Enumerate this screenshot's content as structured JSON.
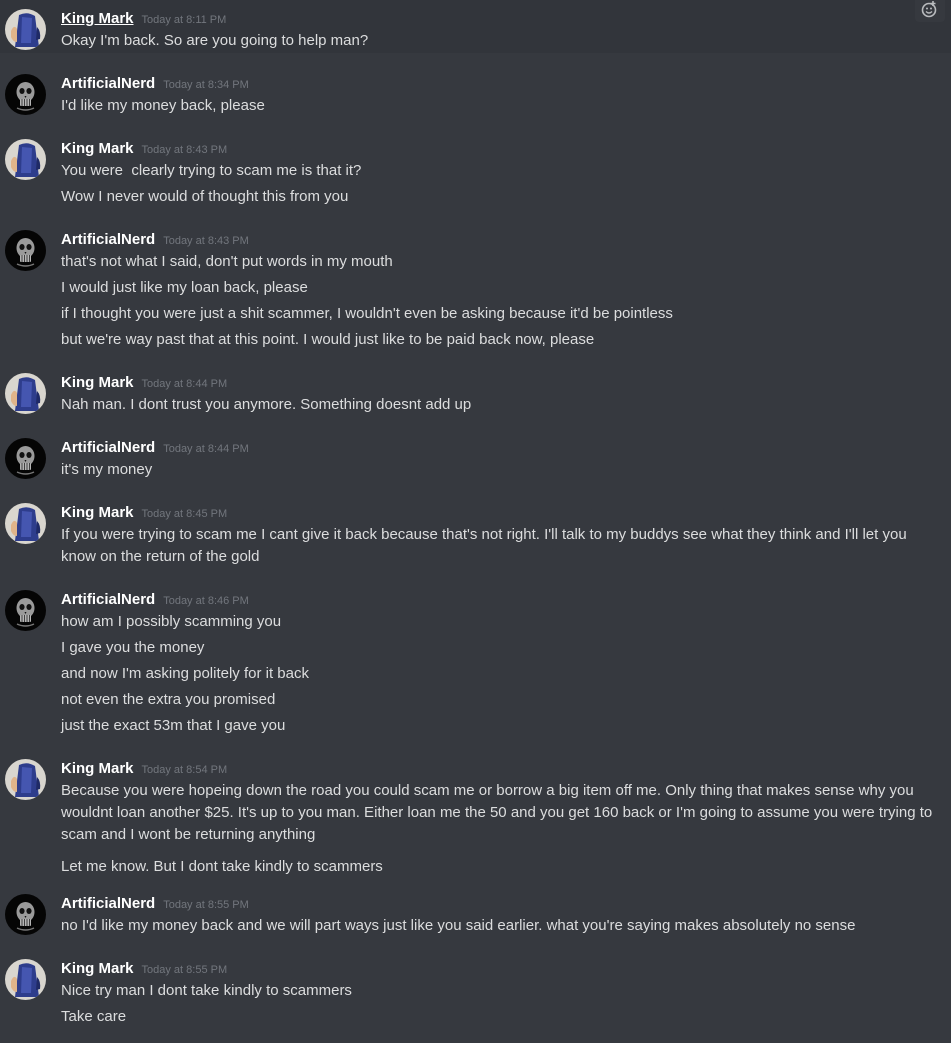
{
  "users": {
    "king": "King Mark",
    "nerd": "ArtificialNerd"
  },
  "colors": {
    "background": "#36393f",
    "highlight": "#32353b",
    "text": "#dcddde",
    "username": "#ffffff",
    "timestamp": "#72767d"
  },
  "toolbar": {
    "add_reaction_icon": "emoji-add-icon"
  },
  "messages": [
    {
      "author": "King Mark",
      "time": "Today at 8:11 PM",
      "lines": [
        "Okay I'm back. So are you going to help man?"
      ]
    },
    {
      "author": "ArtificialNerd",
      "time": "Today at 8:34 PM",
      "lines": [
        "I'd like my money back, please"
      ]
    },
    {
      "author": "King Mark",
      "time": "Today at 8:43 PM",
      "lines": [
        "You were  clearly trying to scam me is that it?",
        "Wow I never would of thought this from you"
      ]
    },
    {
      "author": "ArtificialNerd",
      "time": "Today at 8:43 PM",
      "lines": [
        "that's not what I said, don't put words in my mouth",
        "I would just like my loan back, please",
        "if I thought you were just a shit scammer, I wouldn't even be asking because it'd be pointless",
        "but we're way past that at this point. I would just like to be paid back now, please"
      ]
    },
    {
      "author": "King Mark",
      "time": "Today at 8:44 PM",
      "lines": [
        "Nah man. I dont trust you anymore. Something doesnt add up"
      ]
    },
    {
      "author": "ArtificialNerd",
      "time": "Today at 8:44 PM",
      "lines": [
        "it's my money"
      ]
    },
    {
      "author": "King Mark",
      "time": "Today at 8:45 PM",
      "lines": [
        "If you were trying to scam me I cant give it back because that's not right. I'll talk to my buddys see what they think and I'll let you\nknow on the return of the gold"
      ]
    },
    {
      "author": "ArtificialNerd",
      "time": "Today at 8:46 PM",
      "lines": [
        "how am I possibly scamming you",
        "I gave you the money",
        "and now I'm asking politely for it back",
        "not even the extra you promised",
        "just the exact 53m that I gave you"
      ]
    },
    {
      "author": "King Mark",
      "time": "Today at 8:54 PM",
      "lines": [
        "Because you were hopeing down the road you could scam me or borrow a big item off me. Only thing that makes sense why you\nwouldnt loan another $25. It's up to you man. Either loan me the 50 and you get 160 back or I'm going to assume you were trying to\nscam and I wont be returning anything",
        "Let me know. But I dont take kindly to scammers"
      ]
    },
    {
      "author": "ArtificialNerd",
      "time": "Today at 8:55 PM",
      "lines": [
        "no I'd like my money back and we will part ways just like you said earlier. what you're saying makes absolutely no sense"
      ]
    },
    {
      "author": "King Mark",
      "time": "Today at 8:55 PM",
      "lines": [
        "Nice try man I dont take kindly to scammers",
        "Take care"
      ]
    }
  ]
}
